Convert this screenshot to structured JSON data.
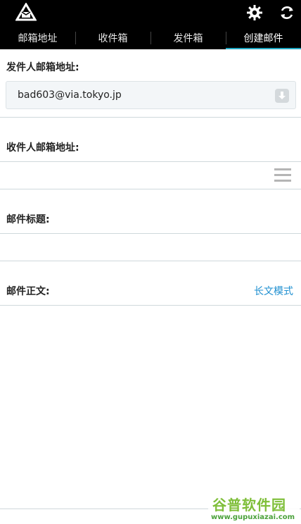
{
  "tabs": [
    {
      "label": "邮箱地址"
    },
    {
      "label": "收件箱"
    },
    {
      "label": "发件箱"
    },
    {
      "label": "创建邮件"
    }
  ],
  "form": {
    "sender_label": "发件人邮箱地址:",
    "sender_value": "bad603@via.tokyo.jp",
    "recipient_label": "收件人邮箱地址:",
    "recipient_value": "",
    "subject_label": "邮件标题:",
    "subject_value": "",
    "body_label": "邮件正文:",
    "long_mode_label": "长文模式"
  },
  "watermark": {
    "brand": "谷普软件园",
    "url": "www.gupuxiazai.com"
  },
  "colors": {
    "topbar": "#000000",
    "tab_active_underline": "#1fa6c2",
    "link": "#1e8fd0",
    "divider": "#cfd8dc"
  },
  "icons": [
    "mail-logo-icon",
    "gear-icon",
    "refresh-icon",
    "download-icon",
    "menu-icon"
  ]
}
